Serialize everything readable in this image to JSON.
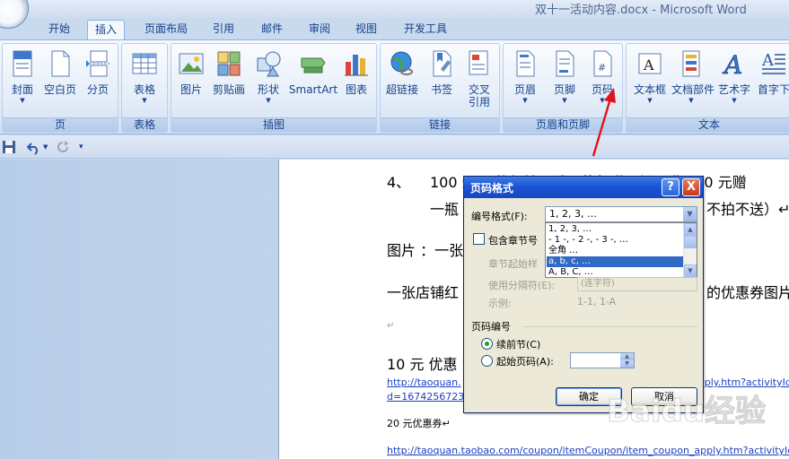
{
  "window": {
    "title": "双十一活动内容.docx - Microsoft Word"
  },
  "tabs": [
    {
      "label": "开始"
    },
    {
      "label": "插入"
    },
    {
      "label": "页面布局"
    },
    {
      "label": "引用"
    },
    {
      "label": "邮件"
    },
    {
      "label": "审阅"
    },
    {
      "label": "视图"
    },
    {
      "label": "开发工具"
    }
  ],
  "ribbon": {
    "groups": [
      {
        "label": "页"
      },
      {
        "label": "表格"
      },
      {
        "label": "插图"
      },
      {
        "label": "链接"
      },
      {
        "label": "页眉和页脚"
      },
      {
        "label": "文本"
      }
    ],
    "buttons": [
      {
        "label": "封面"
      },
      {
        "label": "空白页"
      },
      {
        "label": "分页"
      },
      {
        "label": "表格"
      },
      {
        "label": "图片"
      },
      {
        "label": "剪贴画"
      },
      {
        "label": "形状"
      },
      {
        "label": "SmartArt"
      },
      {
        "label": "图表"
      },
      {
        "label": "超链接"
      },
      {
        "label": "书签"
      },
      {
        "label": "交叉"
      },
      {
        "label": "引用"
      },
      {
        "label": "页眉"
      },
      {
        "label": "页脚"
      },
      {
        "label": "页码"
      },
      {
        "label": "文本框"
      },
      {
        "label": "文档部件"
      },
      {
        "label": "艺术字"
      },
      {
        "label": "首字下"
      }
    ]
  },
  "document": {
    "lines": [
      {
        "text": "4、"
      },
      {
        "text": "100 元 5 款保健品试用装包赠一份，满 300 元赠"
      },
      {
        "text": "一瓶"
      },
      {
        "text": "不拍不送）↵"
      },
      {
        "text": "图片 ：一张"
      },
      {
        "text": "一张店铺红"
      },
      {
        "text": "的优惠券图片"
      },
      {
        "text": "↵"
      },
      {
        "text": "10 元 优惠"
      },
      {
        "text": "20 元优惠券↵"
      }
    ],
    "links": [
      {
        "text": "http://taoquan."
      },
      {
        "text": "apply.htm?activityId="
      },
      {
        "text": "d=1674256723"
      },
      {
        "text": "http://taoquan.taobao.com/coupon/itemCoupon/item_coupon_apply.htm?activityId="
      }
    ]
  },
  "dialog": {
    "title": "页码格式",
    "help": "?",
    "close": "X",
    "number_format_label": "编号格式(F):",
    "number_format_value": "1, 2, 3, …",
    "options": [
      {
        "text": "1, 2, 3, …"
      },
      {
        "text": "- 1 -, - 2 -, - 3 -, …"
      },
      {
        "text": "全角 …"
      },
      {
        "text": "a, b, c, …"
      },
      {
        "text": "A, B, C, …"
      }
    ],
    "selected_option_index": 3,
    "include_chapter_label": "包含章节号",
    "chapter_start_label": "章节起始样",
    "separator_label": "使用分隔符(E):",
    "separator_value": "(连字符)",
    "example_label": "示例:",
    "example_value": "1-1, 1-A",
    "section_label": "页码编号",
    "continue_label": "续前节(C)",
    "start_at_label": "起始页码(A):",
    "ok": "确定",
    "cancel": "取消"
  },
  "watermark": {
    "text": "Baidu经验",
    "sub": "jingyan.baidu.com"
  },
  "colors": {
    "ribbon_text": "#15428b",
    "arrow": "#e0141a",
    "selection": "#316ac5",
    "link": "#1d3fbf"
  }
}
